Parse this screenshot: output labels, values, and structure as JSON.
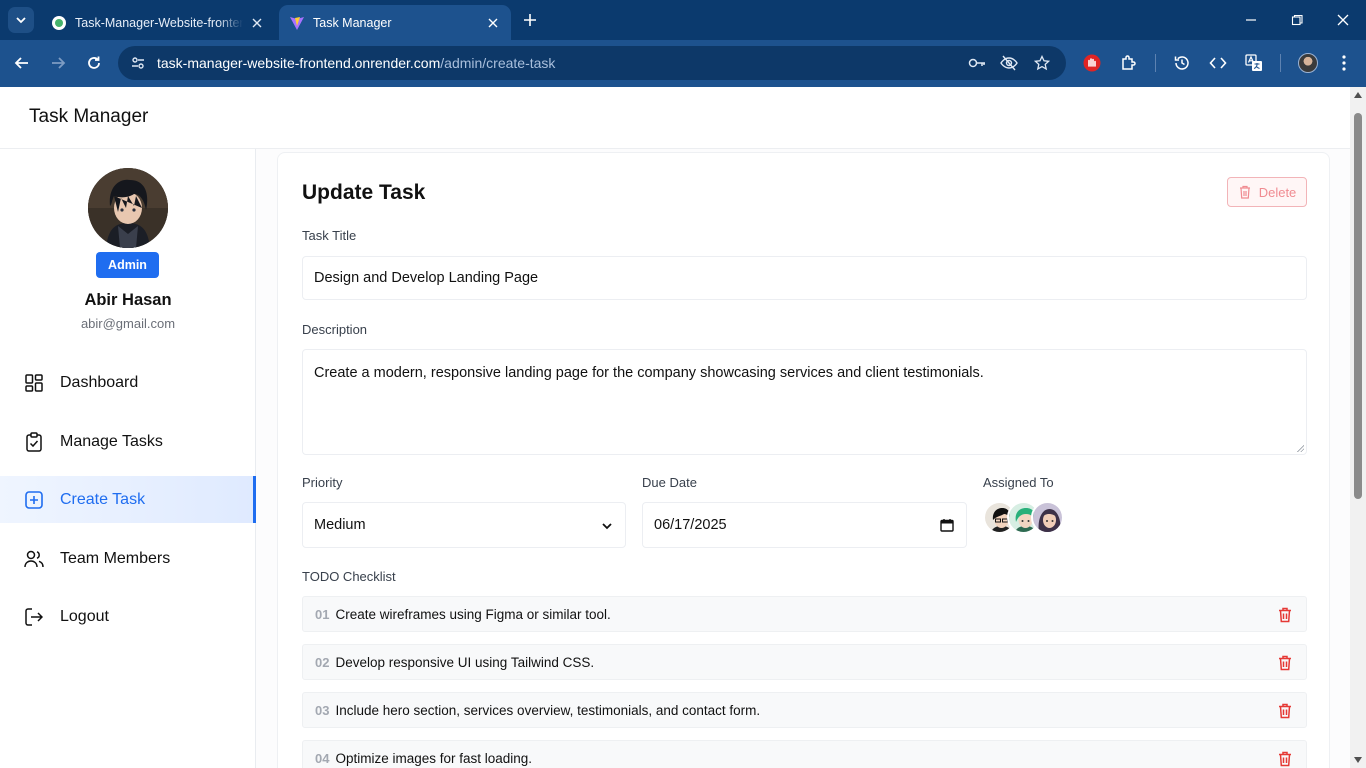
{
  "browser": {
    "tabs": [
      {
        "title": "Task-Manager-Website-frontend",
        "active": false
      },
      {
        "title": "Task Manager",
        "active": true
      }
    ],
    "url_host": "task-manager-website-frontend.onrender.com",
    "url_path": "/admin/create-task"
  },
  "app": {
    "title": "Task Manager"
  },
  "user": {
    "role": "Admin",
    "name": "Abir Hasan",
    "email": "abir@gmail.com"
  },
  "sidebar": {
    "items": [
      {
        "label": "Dashboard",
        "icon": "dashboard-icon"
      },
      {
        "label": "Manage Tasks",
        "icon": "clipboard-check-icon"
      },
      {
        "label": "Create Task",
        "icon": "plus-square-icon",
        "active": true
      },
      {
        "label": "Team Members",
        "icon": "users-icon"
      },
      {
        "label": "Logout",
        "icon": "logout-icon"
      }
    ]
  },
  "form": {
    "heading": "Update Task",
    "delete_label": "Delete",
    "title_label": "Task Title",
    "title_value": "Design and Develop Landing Page",
    "description_label": "Description",
    "description_value": "Create a modern, responsive landing page for the company showcasing services and client testimonials.",
    "priority_label": "Priority",
    "priority_value": "Medium",
    "due_date_label": "Due Date",
    "due_date_value": "06/17/2025",
    "assigned_label": "Assigned To",
    "todo_label": "TODO Checklist",
    "todos": [
      {
        "num": "01",
        "text": "Create wireframes using Figma or similar tool."
      },
      {
        "num": "02",
        "text": "Develop responsive UI using Tailwind CSS."
      },
      {
        "num": "03",
        "text": "Include hero section, services overview, testimonials, and contact form."
      },
      {
        "num": "04",
        "text": "Optimize images for fast loading."
      }
    ]
  },
  "colors": {
    "accent": "#1f6df0",
    "danger": "#e53935",
    "chrome_dark": "#0b3a6e",
    "chrome": "#1d528e"
  }
}
